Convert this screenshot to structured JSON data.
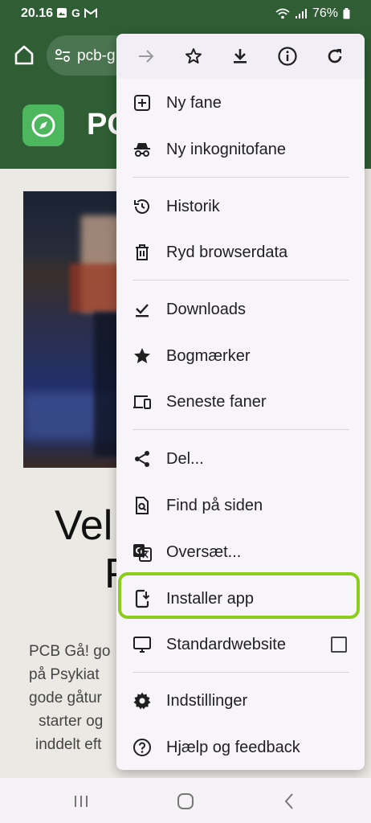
{
  "status_bar": {
    "time": "20.16",
    "g_letter": "G",
    "battery": "76%"
  },
  "browser": {
    "url_text": "pcb-g"
  },
  "page": {
    "brand": "PC",
    "welcome_line1": "Vel",
    "welcome_line2": "P",
    "text_lines": [
      "PCB Gå! go",
      "på Psykiat",
      "gode gåtur",
      "starter og",
      "inddelt eft"
    ]
  },
  "menu": {
    "top_icons": [
      "forward-arrow-icon",
      "star-icon",
      "download-icon",
      "info-icon",
      "refresh-icon"
    ],
    "items": [
      {
        "label": "Ny fane",
        "icon": "new-tab-icon"
      },
      {
        "label": "Ny inkognitofane",
        "icon": "incognito-icon"
      },
      {
        "label": "Historik",
        "icon": "history-icon"
      },
      {
        "label": "Ryd browserdata",
        "icon": "trash-icon"
      },
      {
        "label": "Downloads",
        "icon": "downloads-icon"
      },
      {
        "label": "Bogmærker",
        "icon": "bookmark-star-icon"
      },
      {
        "label": "Seneste faner",
        "icon": "devices-icon"
      },
      {
        "label": "Del...",
        "icon": "share-icon"
      },
      {
        "label": "Find på siden",
        "icon": "find-in-page-icon"
      },
      {
        "label": "Oversæt...",
        "icon": "translate-icon"
      },
      {
        "label": "Installer app",
        "icon": "install-app-icon"
      },
      {
        "label": "Standardwebsite",
        "icon": "desktop-icon"
      },
      {
        "label": "Indstillinger",
        "icon": "settings-gear-icon"
      },
      {
        "label": "Hjælp og feedback",
        "icon": "help-icon"
      }
    ],
    "highlight_color": "#8ccc1a"
  },
  "nav": {
    "icons": [
      "recents-icon",
      "home-circle-icon",
      "back-chevron-icon"
    ]
  }
}
